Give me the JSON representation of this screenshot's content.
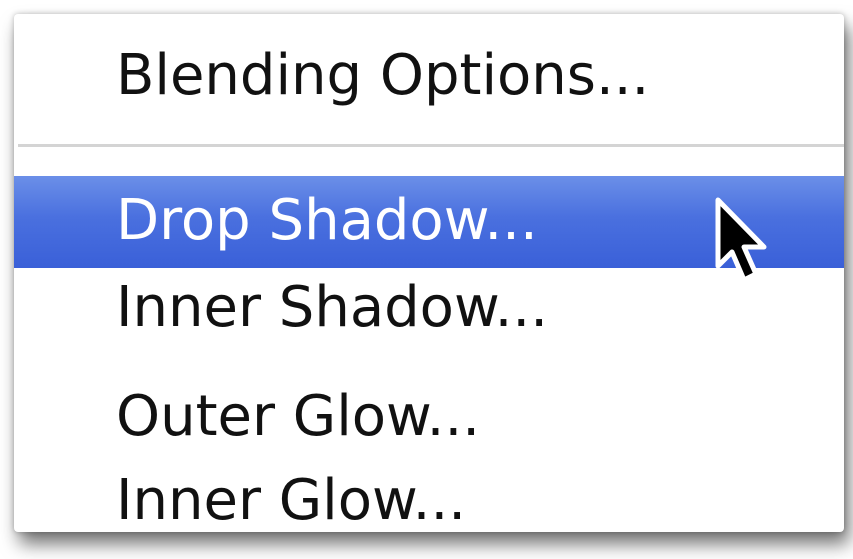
{
  "menu": {
    "items": [
      {
        "label": "Blending Options..."
      },
      {
        "label": "Drop Shadow...",
        "highlighted": true
      },
      {
        "label": "Inner Shadow..."
      },
      {
        "label": "Outer Glow..."
      },
      {
        "label": "Inner Glow..."
      }
    ],
    "highlight_color": "#4a70df",
    "separator_color": "#d4d4d4"
  },
  "cursor": {
    "icon": "arrow-cursor-icon"
  }
}
